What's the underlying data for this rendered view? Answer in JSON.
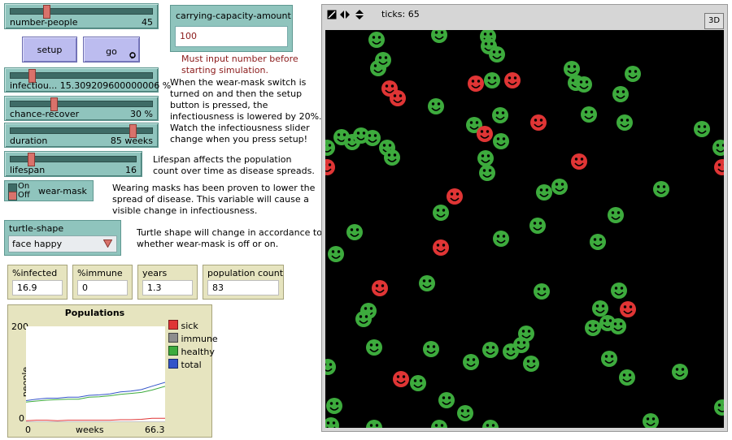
{
  "sliders": {
    "number_people": {
      "label": "number-people",
      "value": "45",
      "level": 0.25
    },
    "infectiousness": {
      "label": "infectiou... 15.309209600000006 %",
      "level": 0.15
    },
    "chance_recover": {
      "label": "chance-recover",
      "value": "30 %",
      "level": 0.3
    },
    "duration": {
      "label": "duration",
      "value": "85 weeks",
      "level": 0.85
    },
    "lifespan": {
      "label": "lifespan",
      "value": "16",
      "level": 0.16
    }
  },
  "buttons": {
    "setup": "setup",
    "go": "go"
  },
  "carrying_capacity": {
    "label": "carrying-capacity-amount",
    "value": "100"
  },
  "notes": {
    "carrying_warning": [
      "Must input number before",
      "starting simulation."
    ],
    "wear_mask_switch": [
      "When the wear-mask switch is",
      "turned on and then the setup",
      "button is pressed, the",
      "infectiousness is lowered by 20%.",
      "Watch the infectiousness slider",
      "change when you press setup!"
    ],
    "lifespan": [
      "Lifespan affects the population",
      "count over time as disease spreads."
    ],
    "wear_mask": [
      "Wearing masks has been proven to lower the",
      "spread of disease. This variable will cause a",
      "visible change in infectiousness."
    ],
    "turtle_shape": [
      "Turtle shape will change in accordance to",
      "whether wear-mask is off or on."
    ]
  },
  "switch": {
    "label": "wear-mask",
    "on": "On",
    "off": "Off",
    "state": "off"
  },
  "chooser": {
    "label": "turtle-shape",
    "value": "face happy"
  },
  "monitors": [
    {
      "label": "%infected",
      "value": "16.9"
    },
    {
      "label": "%immune",
      "value": "0"
    },
    {
      "label": "years",
      "value": "1.3"
    },
    {
      "label": "population count",
      "value": "83"
    }
  ],
  "world": {
    "ticks_label": "ticks: 65",
    "three_d": "3D"
  },
  "colors": {
    "sick": "#e03535",
    "immune": "#8d8d8d",
    "healthy": "#3dab3d",
    "total": "#3354c9",
    "world_bg": "#000000"
  },
  "chart_data": {
    "type": "line",
    "title": "Populations",
    "xlabel": "weeks",
    "ylabel": "people",
    "xlim": [
      0,
      66.3
    ],
    "ylim": [
      0,
      200
    ],
    "x_tick_labels": [
      "0",
      "66.3"
    ],
    "y_tick_labels": [
      "0",
      "200"
    ],
    "legend_position": "right",
    "x": [
      0,
      5,
      10,
      15,
      20,
      25,
      30,
      35,
      40,
      45,
      50,
      55,
      60,
      66.3
    ],
    "series": [
      {
        "name": "sick",
        "values": [
          3,
          4,
          4,
          3,
          4,
          4,
          4,
          4,
          4,
          5,
          5,
          6,
          8,
          8
        ]
      },
      {
        "name": "immune",
        "values": [
          0,
          0,
          0,
          0,
          0,
          0,
          0,
          0,
          0,
          0,
          0,
          0,
          0,
          0
        ]
      },
      {
        "name": "healthy",
        "values": [
          42,
          44,
          46,
          47,
          48,
          48,
          52,
          53,
          55,
          58,
          60,
          62,
          67,
          75
        ]
      },
      {
        "name": "total",
        "values": [
          45,
          48,
          50,
          50,
          52,
          52,
          56,
          57,
          59,
          63,
          65,
          68,
          75,
          83
        ]
      }
    ]
  }
}
